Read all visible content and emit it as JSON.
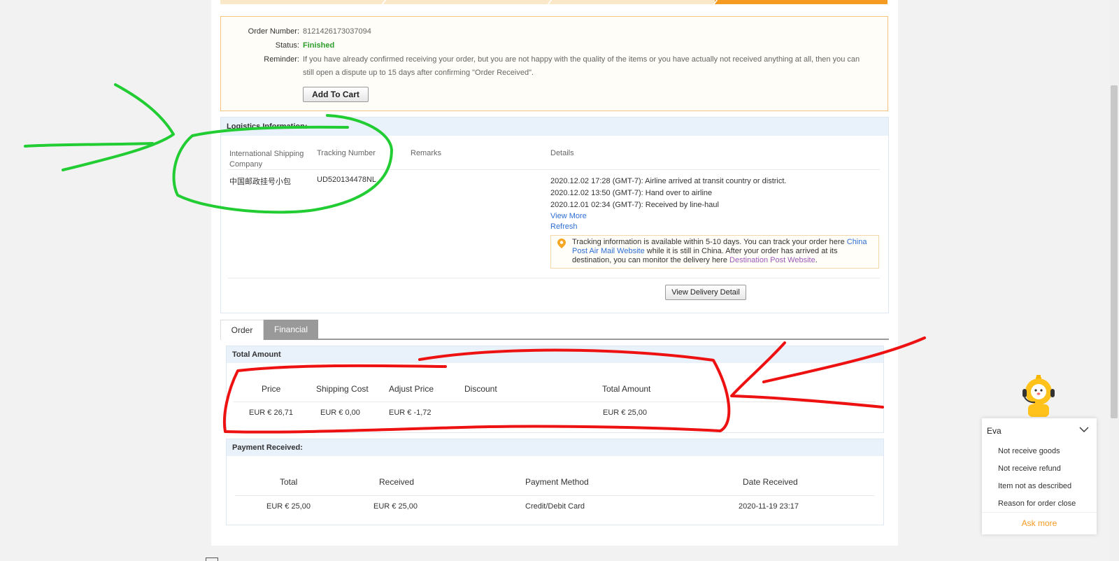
{
  "order": {
    "number_label": "Order Number:",
    "number": "8121426173037094",
    "status_label": "Status:",
    "status": "Finished",
    "reminder_label": "Reminder:",
    "reminder": "If you have already confirmed receiving your order, but you are not happy with the quality of the items or you have actually not received anything at all, then you can still open a dispute up to 15 days after confirming \"Order Received\".",
    "add_to_cart": "Add To Cart"
  },
  "logistics": {
    "title": "Logistics Information:",
    "headers": {
      "company": "International Shipping Company",
      "tracking": "Tracking Number",
      "remarks": "Remarks",
      "details": "Details"
    },
    "company": "中国邮政挂号小包",
    "tracking_number": "UD520134478NL",
    "events": [
      "2020.12.02 17:28 (GMT-7): Airline arrived at transit country or district.",
      "2020.12.02 13:50 (GMT-7): Hand over to airline",
      "2020.12.01 02:34 (GMT-7): Received by line-haul"
    ],
    "view_more": "View More",
    "refresh": "Refresh",
    "tip": {
      "part1": "Tracking information is available within 5-10 days. You can track your order here ",
      "link1": "China Post Air Mail Website",
      "part2": " while it is still in China. After your order has arrived at its destination, you can monitor the delivery here ",
      "link2": "Destination Post Website",
      "part3": "."
    },
    "view_delivery_detail": "View Delivery Detail"
  },
  "tabs": {
    "order": "Order",
    "financial": "Financial"
  },
  "total_amount": {
    "title": "Total Amount",
    "headers": [
      "Price",
      "Shipping Cost",
      "Adjust Price",
      "Discount",
      "Total Amount"
    ],
    "values": [
      "EUR € 26,71",
      "EUR € 0,00",
      "EUR € -1,72",
      "",
      "EUR € 25,00"
    ]
  },
  "payment": {
    "title": "Payment Received:",
    "headers": [
      "Total",
      "Received",
      "Payment Method",
      "Date Received"
    ],
    "values": [
      "EUR € 25,00",
      "EUR € 25,00",
      "Credit/Debit Card",
      "2020-11-19 23:17"
    ]
  },
  "eva": {
    "name": "Eva",
    "items": [
      "Not receive goods",
      "Not receive refund",
      "Item not as described",
      "Reason for order close"
    ],
    "ask_more": "Ask more"
  },
  "colors": {
    "accent_orange": "#f59b22",
    "status_green": "#2a9d2a",
    "link_blue": "#2f6ed3",
    "annotation_green": "#22cc33",
    "annotation_red": "#ee1111"
  }
}
